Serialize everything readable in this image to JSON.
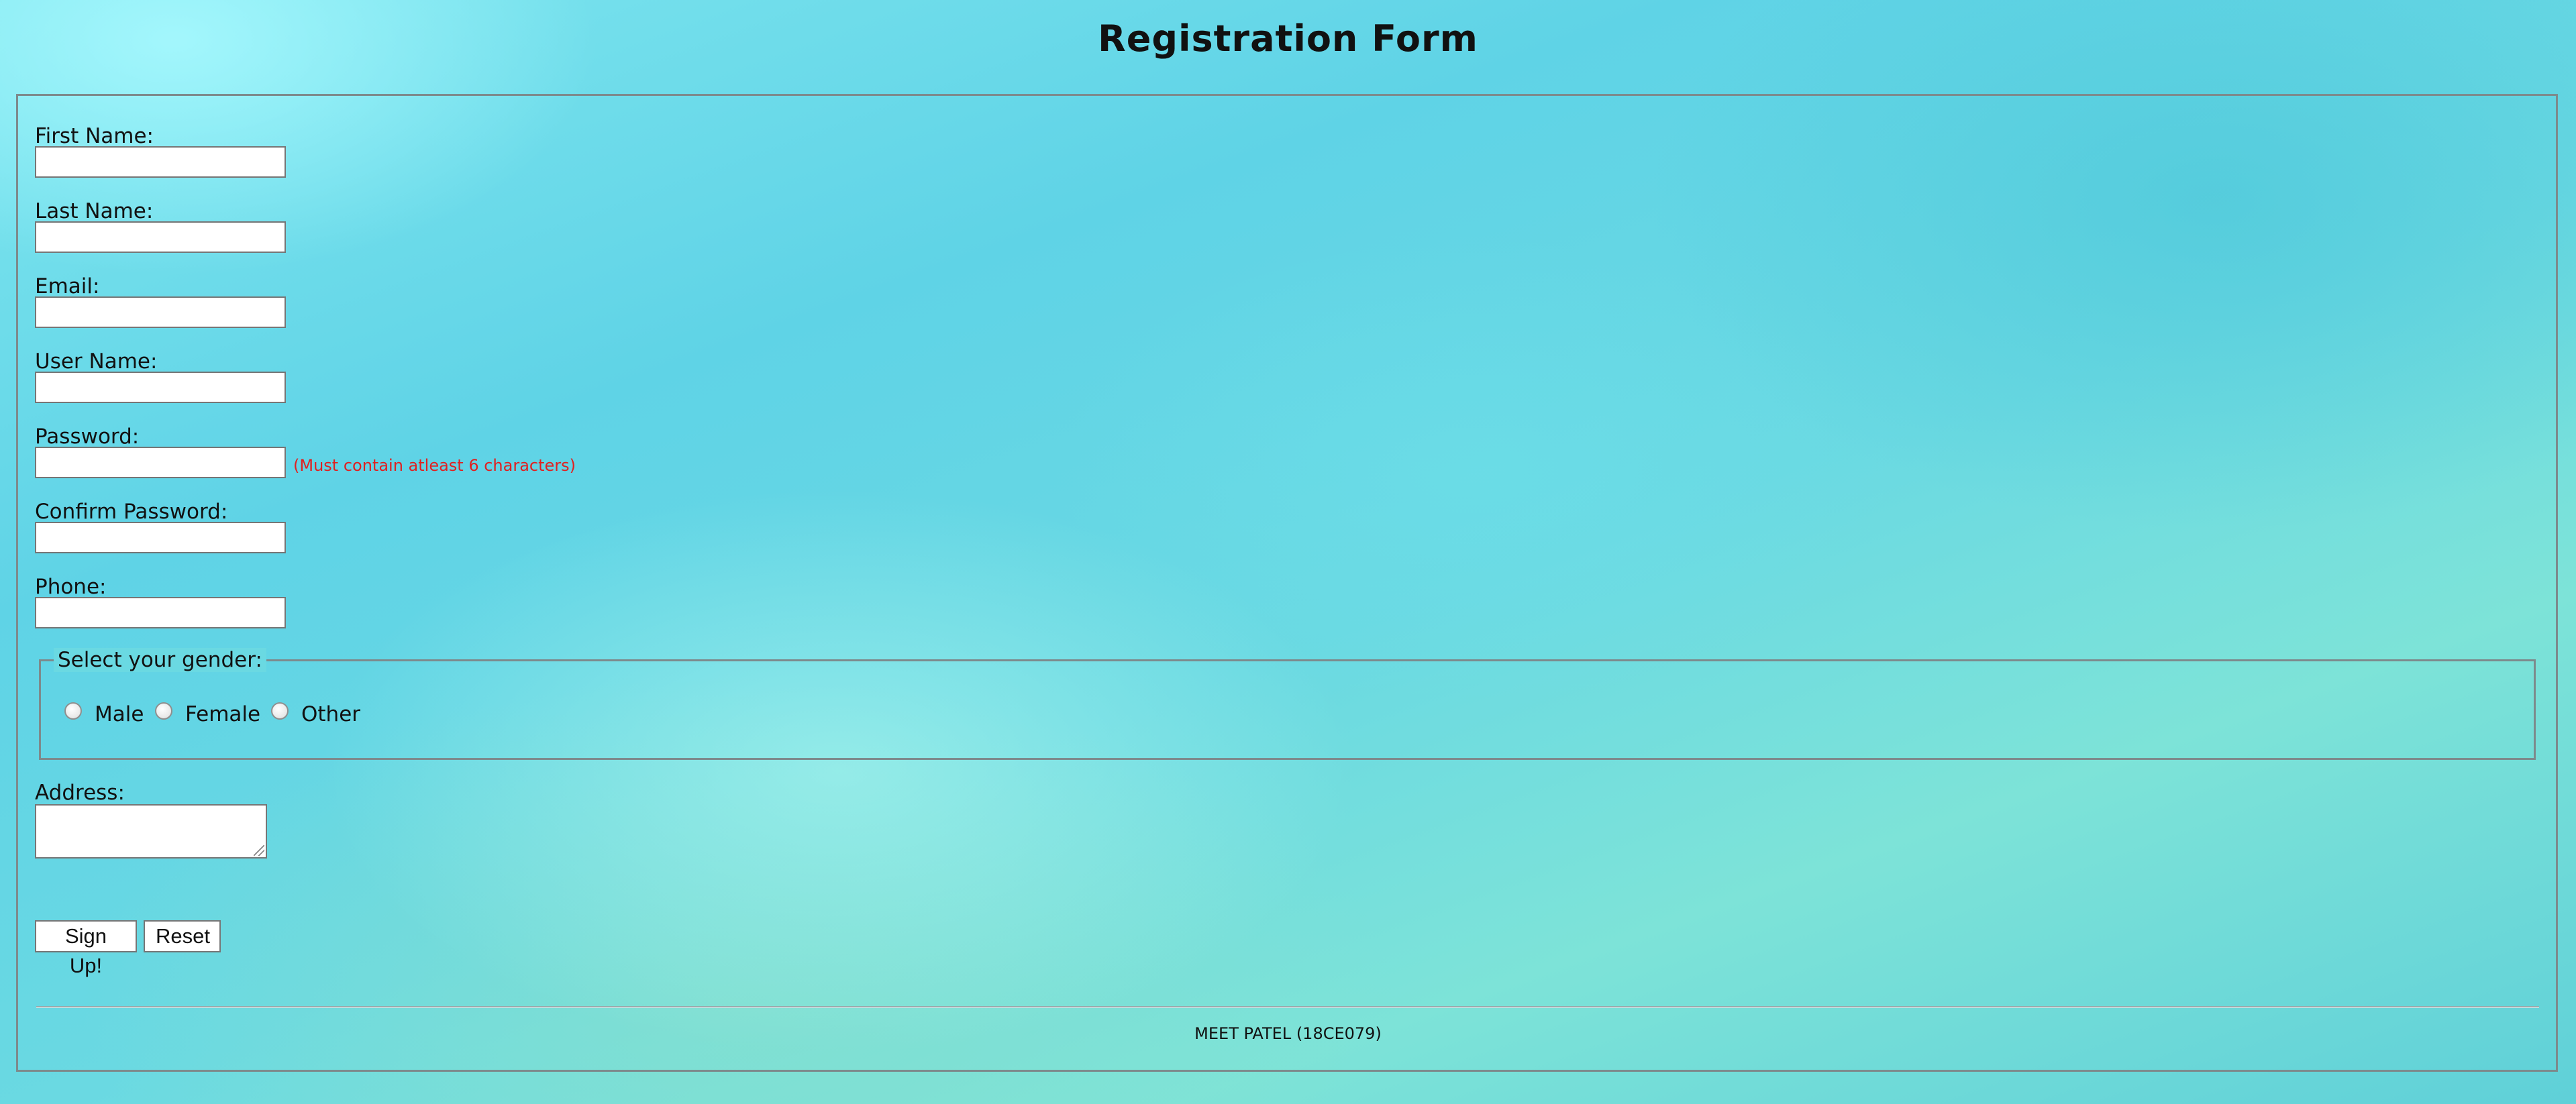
{
  "page": {
    "title": "Registration Form"
  },
  "form": {
    "first_name": {
      "label": "First Name:",
      "value": ""
    },
    "last_name": {
      "label": "Last Name:",
      "value": ""
    },
    "email": {
      "label": "Email:",
      "value": ""
    },
    "user_name": {
      "label": "User Name:",
      "value": ""
    },
    "password": {
      "label": "Password:",
      "value": "",
      "hint": "(Must contain atleast 6 characters)"
    },
    "confirm_password": {
      "label": "Confirm Password:",
      "value": ""
    },
    "phone": {
      "label": "Phone:",
      "value": ""
    },
    "gender": {
      "legend": "Select your gender:",
      "options": [
        "Male",
        "Female",
        "Other"
      ],
      "selected": null
    },
    "address": {
      "label": "Address:",
      "value": ""
    },
    "buttons": {
      "submit_label": "Sign Up!",
      "reset_label": "Reset"
    }
  },
  "footer": {
    "text": "MEET PATEL (18CE079)"
  },
  "colors": {
    "hint_red": "#e02020",
    "border_gray": "#7d8a8c"
  }
}
